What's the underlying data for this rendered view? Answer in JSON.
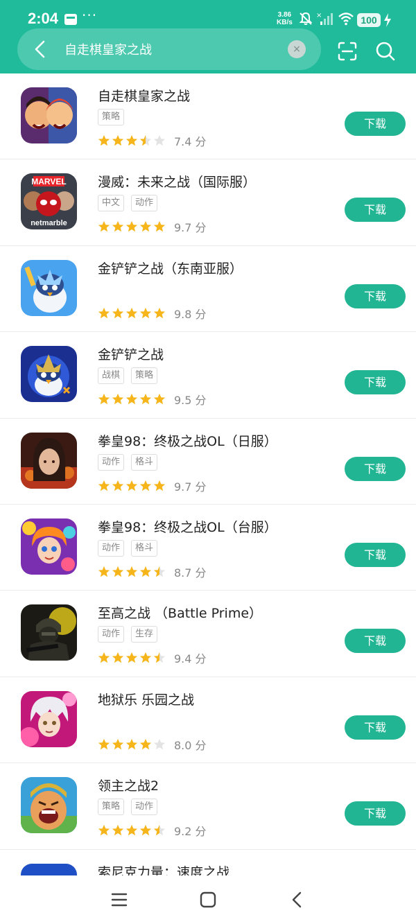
{
  "status": {
    "time": "2:04",
    "dots": "···",
    "speed_value": "3.86",
    "speed_unit": "KB/s",
    "battery": "100"
  },
  "search": {
    "query": "自走棋皇家之战",
    "clear_label": "×"
  },
  "download_label": "下载",
  "score_unit": "分",
  "colors": {
    "brand": "#20bb9a",
    "button": "#21b593",
    "star": "#f6b51a",
    "star_empty": "#e3e3e3"
  },
  "apps": [
    {
      "name": "自走棋皇家之战",
      "tags": [
        "策略"
      ],
      "stars": 3.5,
      "score": "7.4"
    },
    {
      "name": "漫威：未来之战（国际服）",
      "tags": [
        "中文",
        "动作"
      ],
      "stars": 5,
      "score": "9.7",
      "icon_text_top": "MARVEL",
      "icon_text_bottom": "netmarble"
    },
    {
      "name": "金铲铲之战（东南亚服）",
      "tags": [],
      "stars": 5,
      "score": "9.8"
    },
    {
      "name": "金铲铲之战",
      "tags": [
        "战棋",
        "策略"
      ],
      "stars": 5,
      "score": "9.5"
    },
    {
      "name": "拳皇98：终极之战OL（日服）",
      "tags": [
        "动作",
        "格斗"
      ],
      "stars": 5,
      "score": "9.7"
    },
    {
      "name": "拳皇98：终极之战OL（台服）",
      "tags": [
        "动作",
        "格斗"
      ],
      "stars": 4.5,
      "score": "8.7"
    },
    {
      "name": "至高之战 （Battle Prime）",
      "tags": [
        "动作",
        "生存"
      ],
      "stars": 4.5,
      "score": "9.4"
    },
    {
      "name": "地狱乐 乐园之战",
      "tags": [],
      "stars": 4,
      "score": "8.0"
    },
    {
      "name": "领主之战2",
      "tags": [
        "策略",
        "动作"
      ],
      "stars": 4.5,
      "score": "9.2"
    },
    {
      "name": "索尼克力量：速度之战",
      "tags": [],
      "stars": 0,
      "score": ""
    }
  ]
}
